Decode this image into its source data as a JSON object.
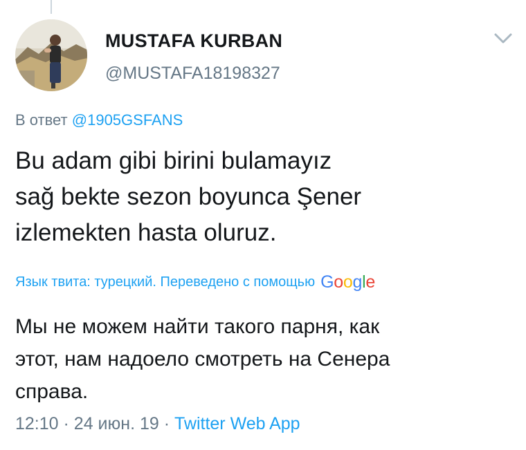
{
  "tweet": {
    "author": {
      "display_name": "MUSTAFA KURBAN",
      "handle": "@MUSTAFA18198327"
    },
    "reply_prefix": "В ответ",
    "reply_to": "@1905GSFANS",
    "text_lines": [
      "Bu adam gibi birini bulamayız",
      "sağ bekte sezon boyunca Şener",
      "izlemekten hasta oluruz."
    ],
    "translation_notice": "Язык твита: турецкий. Переведено с помощью",
    "translation_provider": "Google",
    "translation_lines": [
      "Мы не можем найти такого парня, как",
      "этот, нам надоело смотреть на Сенера",
      "справа."
    ],
    "time": "12:10",
    "separator": "·",
    "date": "24 июн. 19",
    "source_app": "Twitter Web App"
  },
  "icons": {
    "avatar": "profile-photo",
    "menu": "chevron-down-icon"
  },
  "colors": {
    "text": "#14171a",
    "secondary": "#657786",
    "link": "#1da1f2",
    "google_blue": "#4285f4",
    "google_red": "#ea4335",
    "google_yellow": "#fbbc05",
    "google_green": "#34a853"
  }
}
